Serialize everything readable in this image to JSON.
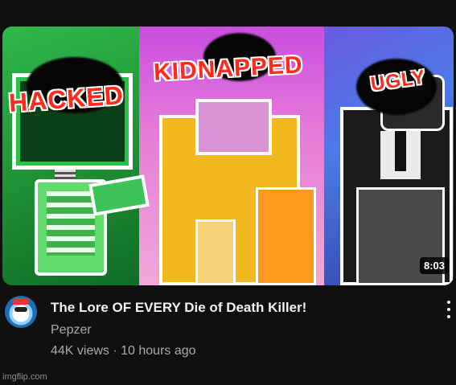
{
  "video": {
    "thumbnail": {
      "labels": {
        "left": "HACKED",
        "center": "KIDNAPPED",
        "right": "UGLY"
      },
      "duration": "8:03"
    },
    "title": "The Lore OF EVERY Die of Death Killer!",
    "channel": "Pepzer",
    "stats": "44K views · 10 hours ago"
  },
  "icons": {
    "menu": "more-vert-icon",
    "avatar": "channel-avatar"
  },
  "watermark": "imgflip.com",
  "colors": {
    "background": "#0f0f0f",
    "title": "#f1f1f1",
    "secondary_text": "#aaaaaa",
    "label_red": "#ff2a1a"
  }
}
